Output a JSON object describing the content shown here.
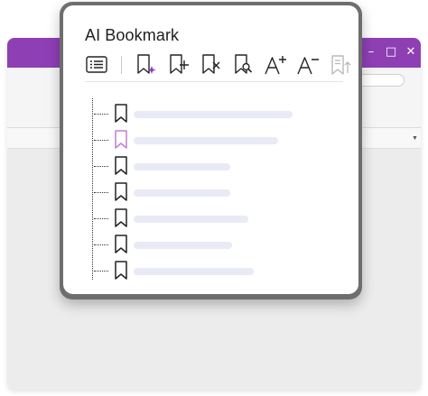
{
  "background_window": {
    "titlebar_color": "#8e3fb4",
    "controls": [
      "minimize-icon",
      "maximize-icon",
      "close-icon"
    ]
  },
  "panel": {
    "title": "AI Bookmark",
    "toolbar": [
      {
        "name": "bookmark-list-icon"
      },
      {
        "name": "ai-generate-bookmark-icon",
        "accent": "#8e3fb4"
      },
      {
        "name": "add-bookmark-icon"
      },
      {
        "name": "delete-bookmark-icon"
      },
      {
        "name": "find-bookmark-icon"
      },
      {
        "name": "increase-font-icon"
      },
      {
        "name": "decrease-font-icon"
      },
      {
        "name": "sort-bookmark-icon",
        "disabled": true
      }
    ],
    "bookmarks": [
      {
        "text_bar_fill": 0.86,
        "selected": false
      },
      {
        "text_bar_fill": 0.78,
        "selected": true
      },
      {
        "text_bar_fill": 0.52,
        "selected": false
      },
      {
        "text_bar_fill": 0.52,
        "selected": false
      },
      {
        "text_bar_fill": 0.62,
        "selected": false
      },
      {
        "text_bar_fill": 0.53,
        "selected": false
      },
      {
        "text_bar_fill": 0.65,
        "selected": false
      }
    ],
    "colors": {
      "selected_bookmark": "#c47fd0",
      "bookmark": "#222222",
      "placeholder_bar": "#e8ebf5"
    }
  }
}
